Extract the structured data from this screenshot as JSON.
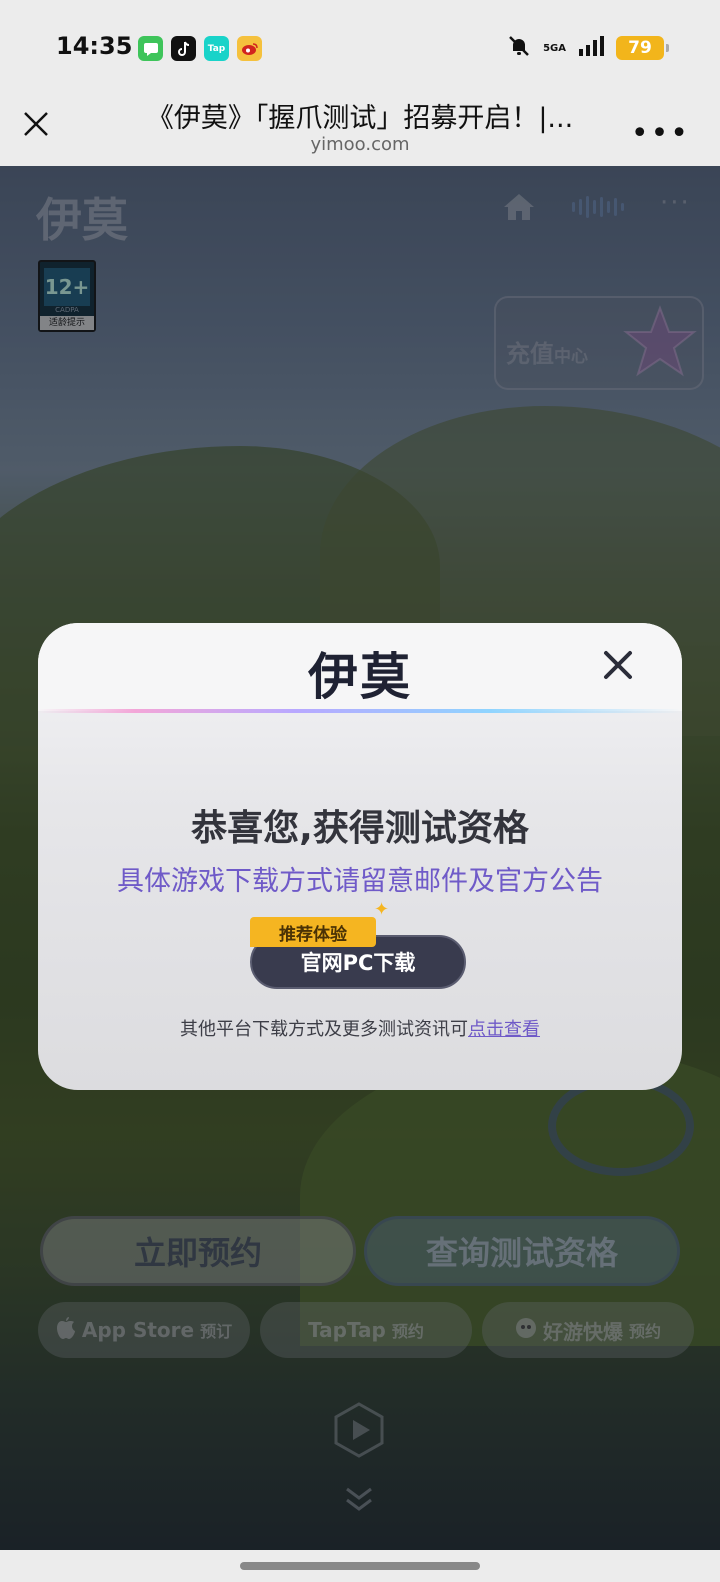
{
  "status_bar": {
    "time": "14:35",
    "apps": [
      "message-icon",
      "tiktok-icon",
      "taptap-icon",
      "weibo-icon"
    ],
    "tap_label": "Tap",
    "network": "5GA",
    "battery": "79",
    "battery_color": "#f2b51b"
  },
  "browser": {
    "title": "《伊莫》「握爪测试」招募开启！|...",
    "url": "yimoo.com"
  },
  "site": {
    "logo": "伊莫",
    "age_badge": {
      "rating": "12+",
      "org": "CADPA",
      "label": "适龄提示"
    },
    "recharge": {
      "main": "充值",
      "sub": "中心"
    },
    "reserve_button": "立即预约",
    "query_button": "查询测试资格",
    "stores": [
      {
        "name": "App Store",
        "action": "预订"
      },
      {
        "name": "TapTap",
        "action": "预约"
      },
      {
        "name": "好游快爆",
        "action": "预约"
      }
    ]
  },
  "modal": {
    "logo": "伊莫",
    "title": "恭喜您,获得测试资格",
    "subtitle": "具体游戏下载方式请留意邮件及官方公告",
    "tag": "推荐体验",
    "download_button": "官网PC下载",
    "footer_text": "其他平台下载方式及更多测试资讯可",
    "footer_link": "点击查看",
    "accent_color": "#6f5ac8"
  }
}
